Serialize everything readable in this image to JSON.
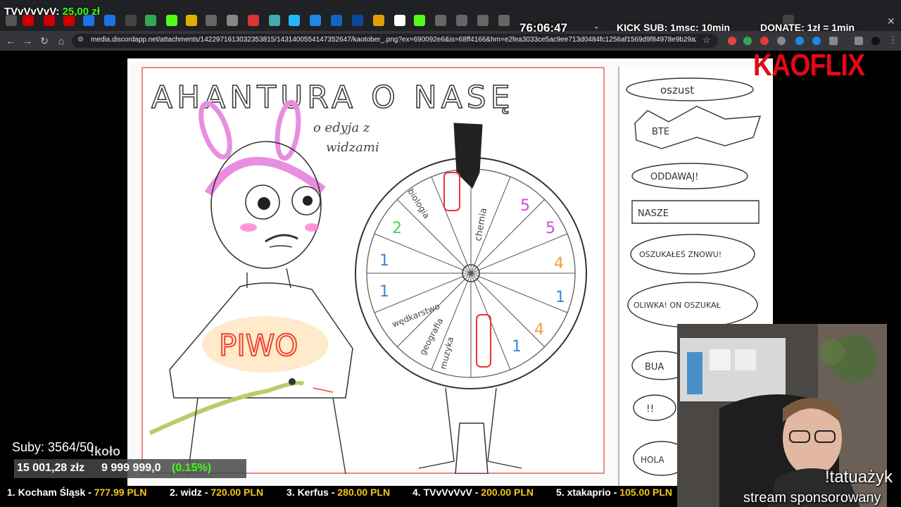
{
  "browser": {
    "url": "media.discordapp.net/attachments/1422971613032353815/1431400554147352647/kaotober_.png?ex=690092e6&is=68ff4166&hm=e2fea3033ce5ac9ee713d0484fc1256af1569d9f84978e9b29a30f837484575a..."
  },
  "overlay": {
    "donor_name": "TVvVvVvV:",
    "donor_amount": "25,00 zł",
    "timer": "76:06:47",
    "timer_sep": "-",
    "kick_sub": "KICK SUB: 1msc: 10min",
    "donate": "DONATE: 1zł = 1min",
    "logo": "KAOFLIX"
  },
  "stats": {
    "subs": "Suby: 3564/50",
    "kolo": "!koło",
    "raised": "15 001,28 złz",
    "goal": "9 999 999,0",
    "percent": "(0.15%)",
    "goal_fraction": 0.0015
  },
  "ticker": [
    {
      "rank": "1. Kocham Śląsk",
      "value": "777.99 PLN"
    },
    {
      "rank": "2. widz",
      "value": "720.00 PLN"
    },
    {
      "rank": "3. Kerfus",
      "value": "280.00 PLN"
    },
    {
      "rank": "4. TVvVvVvV",
      "value": "200.00 PLN"
    },
    {
      "rank": "5. xtakaprio",
      "value": "105.00 PLN"
    }
  ],
  "drawing": {
    "title": "AHANTURA O NASĘ",
    "subtitle_1": "o edyja z",
    "subtitle_2": "widzami",
    "shirt": "PIWO",
    "wheel_labels": [
      "biologia",
      "chemia",
      "wędkarstwo",
      "geografia",
      "muzyka"
    ],
    "wheel_numbers": [
      "5",
      "5",
      "4",
      "1",
      "4",
      "1",
      "1",
      "1",
      "2"
    ],
    "bubbles": [
      "oszust",
      "BTE",
      "ODDAWAJ!",
      "NASZE",
      "OSZUKAŁEŚ ZNOWU!",
      "OLIWKA! ON OSZUKAŁ",
      "BUA",
      "!!",
      "HOLA"
    ]
  },
  "webcam": {
    "command": "!tatuażyk",
    "sponsor": "stream sponsorowany"
  },
  "colors": {
    "accent_green": "#39ff14",
    "logo_red": "#e50914",
    "ticker_value": "#f5c518",
    "sheet_border": "#ee8888"
  }
}
